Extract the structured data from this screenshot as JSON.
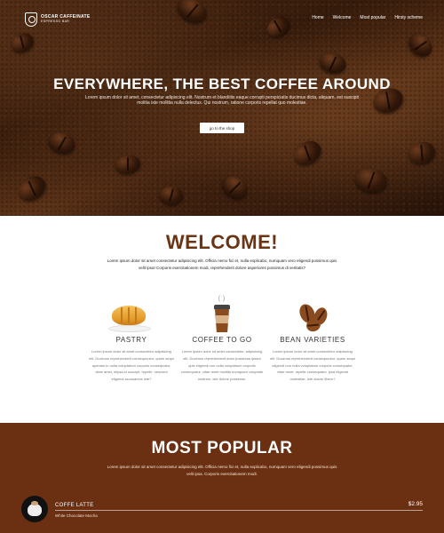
{
  "brand": {
    "title": "OSCAR CAFFEINATE",
    "subtitle": "ESPRESSO BAR"
  },
  "nav": {
    "items": [
      "Home",
      "Welcome",
      "Most popular",
      "Hirsty scheme"
    ]
  },
  "hero": {
    "title": "EVERYWHERE, THE BEST COFFEE AROUND",
    "text": "Lorem ipsum dolor sit amet, consectetur adipiscing elit. Nostrum et blanditiis eaque corrupti perspiciatis ducimus dicta, aliquam, est suscipit molitia iste mollitia nulla delectus. Qui nostrum, ratione corporis repellat quo molestiae.",
    "button": "go to the shop"
  },
  "welcome": {
    "title": "WELCOME!",
    "text": "Lorem ipsum dolor sit amet consectetur adipisicing elit. Officia nemo fici et, nulla explicabo, numquam vero eligendi possimus quis velit ipsa! Corporis exercitationem modi, reprehenderit dolore asperiores possimus di veritatis?"
  },
  "features": [
    {
      "name": "PASTRY",
      "text": "Lorem ipsum dolor sit amet consectetur adipisicing elit. Ducimus reprehenderit consequuntur, quam sequi aperiam in nulla voluptatum corporis consequatur, vitae amet, elipsa id suscipit, repelle, nesciunt eligendi accusamus iste?"
    },
    {
      "name": "COFFEE TO GO",
      "text": "Lorem ipsum dolor sit amet consectetur, adipisicing elit. Ducimus reprehenderit dolor possimus ipsam quis eligendi non nulla voluptatum corporis consequatur, vitae amet mollitia numquam voluptate nostrum, iste dolore possimus."
    },
    {
      "name": "BEAN VARIETIES",
      "text": "Lorem ipsum dolor sit amet consectetur adipisicing elit. Ducimus reprehenderit consequuntur, quam sequi eligendi non nulla voluptatum corporis consequatur, vitae amet, repelle consequatur, ipsa eligendi molestiae, iste dolore libero?"
    }
  ],
  "popular": {
    "title": "MOST POPULAR",
    "text": "Lorem ipsum dolor sit amet consectetur adipisicing elit. Officia nemo fici et, nulla explicabo, numquam vero eligendi possimus quis velit ipsa. Corporis exercitationem modi.",
    "item": {
      "name": "COFFE LATTE",
      "sub": "White Chocolate Mocha",
      "price": "$2.95"
    }
  },
  "colors": {
    "brand_brown": "#6b3515",
    "popular_bg": "#6b2f12"
  },
  "icons": [
    "croissant-icon",
    "coffee-cup-icon",
    "coffee-beans-icon"
  ]
}
